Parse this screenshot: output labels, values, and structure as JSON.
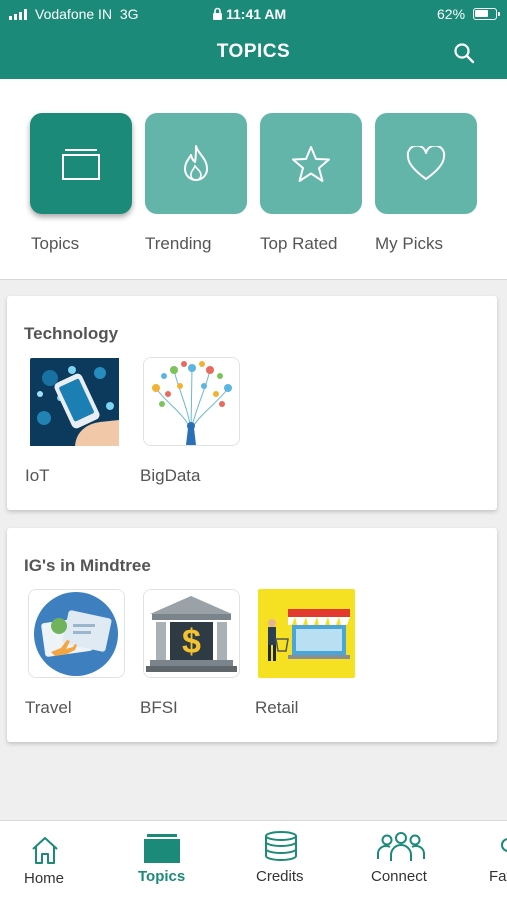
{
  "status_bar": {
    "carrier": "Vodafone IN",
    "network": "3G",
    "time": "11:41 AM",
    "battery": "62%"
  },
  "header": {
    "title": "TOPICS",
    "search_icon": "search-icon"
  },
  "filters": [
    {
      "label": "Topics",
      "icon": "folder-icon",
      "active": true
    },
    {
      "label": "Trending",
      "icon": "flame-icon",
      "active": false
    },
    {
      "label": "Top Rated",
      "icon": "star-icon",
      "active": false
    },
    {
      "label": "My Picks",
      "icon": "heart-icon",
      "active": false
    }
  ],
  "sections": [
    {
      "title": "Technology",
      "items": [
        {
          "label": "IoT",
          "image": "iot-image"
        },
        {
          "label": "BigData",
          "image": "bigdata-image"
        }
      ]
    },
    {
      "title": "IG's in Mindtree",
      "items": [
        {
          "label": "Travel",
          "image": "travel-image"
        },
        {
          "label": "BFSI",
          "image": "bfsi-image"
        },
        {
          "label": "Retail",
          "image": "retail-image"
        }
      ]
    }
  ],
  "bottom_nav": [
    {
      "label": "Home",
      "icon": "home-icon",
      "active": false
    },
    {
      "label": "Topics",
      "icon": "topics-icon",
      "active": true
    },
    {
      "label": "Credits",
      "icon": "credits-icon",
      "active": false
    },
    {
      "label": "Connect",
      "icon": "connect-icon",
      "active": false
    },
    {
      "label": "Fav",
      "icon": "favourites-icon",
      "active": false
    }
  ],
  "colors": {
    "primary": "#1b8a79",
    "primary_light": "#63b5aa",
    "background": "#efefef"
  }
}
